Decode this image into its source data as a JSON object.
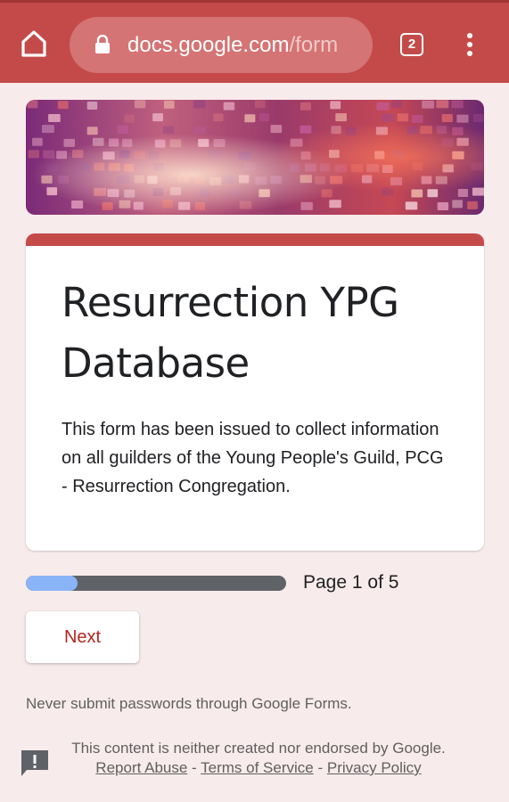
{
  "browser": {
    "url_host": "docs.google.com",
    "url_path": "/form",
    "tab_count": "2",
    "icons": {
      "home": "home-icon",
      "lock": "lock-icon",
      "menu": "more-vert-icon"
    }
  },
  "form": {
    "title": "Resurrection YPG Database",
    "description": "This form has been issued to collect information on all guilders of the Young People's Guild, PCG - Resurrection Congregation.",
    "accent_color": "#c44a4a"
  },
  "progress": {
    "label": "Page 1 of 5",
    "fraction": 0.2,
    "fill_color": "#8ab4f8"
  },
  "actions": {
    "next_label": "Next"
  },
  "notices": {
    "password_warning": "Never submit passwords through Google Forms.",
    "disclaimer": "This content is neither created nor endorsed by Google.",
    "report_abuse": "Report Abuse",
    "separator": "-",
    "terms": "Terms of Service",
    "privacy": "Privacy Policy",
    "report_icon": "feedback-icon"
  }
}
